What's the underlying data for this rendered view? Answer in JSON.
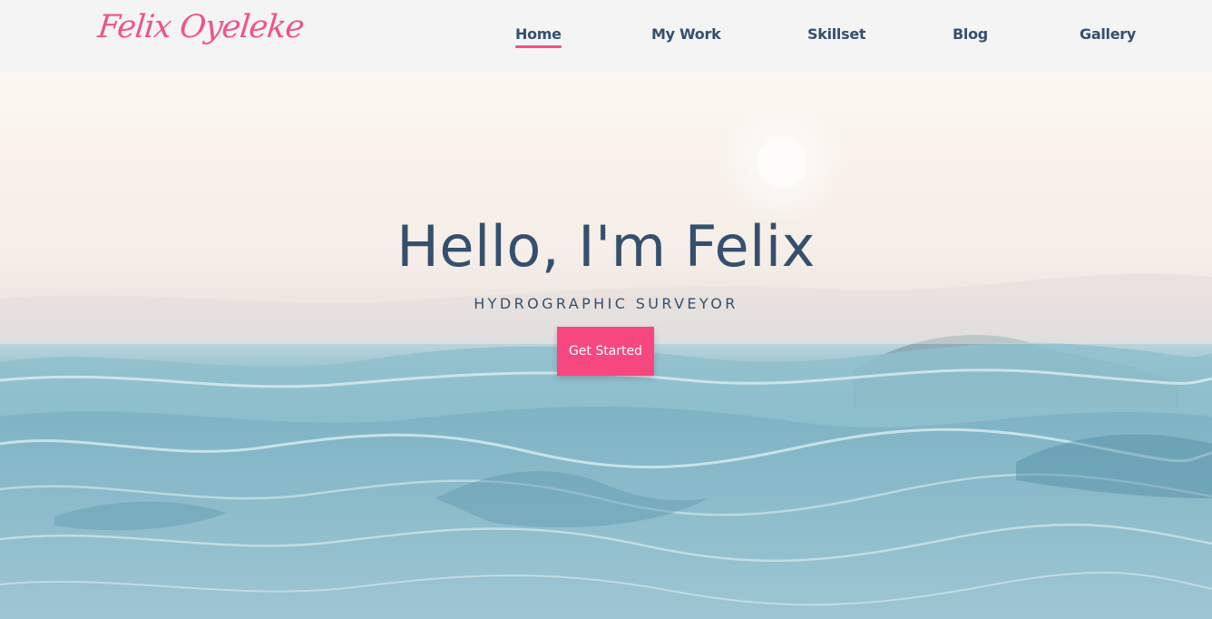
{
  "brand": {
    "logo_text": "Felix Oyeleke",
    "accent_color": "#f0528a"
  },
  "nav": {
    "items": [
      {
        "label": "Home",
        "active": true
      },
      {
        "label": "My Work",
        "active": false
      },
      {
        "label": "Skillset",
        "active": false
      },
      {
        "label": "Blog",
        "active": false
      },
      {
        "label": "Gallery",
        "active": false
      }
    ],
    "text_color": "#34506e"
  },
  "hero": {
    "title": "Hello, I'm Felix",
    "subtitle": "HYDROGRAPHIC SURVEYOR",
    "cta_label": "Get Started",
    "cta_color": "#f7477f",
    "background": "ocean-waves-photo"
  }
}
